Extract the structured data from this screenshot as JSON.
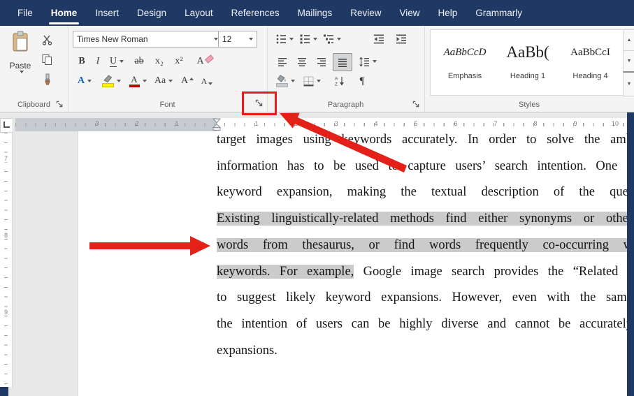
{
  "tabs": {
    "items": [
      "File",
      "Home",
      "Insert",
      "Design",
      "Layout",
      "References",
      "Mailings",
      "Review",
      "View",
      "Help",
      "Grammarly"
    ],
    "active": "Home"
  },
  "ribbon": {
    "clipboard": {
      "label": "Clipboard",
      "paste": "Paste"
    },
    "font": {
      "label": "Font",
      "name": "Times New Roman",
      "size": "12",
      "bold": "B",
      "italic": "I",
      "underline": "U",
      "strike": "ab",
      "subscript": "x₂",
      "superscript": "x²",
      "clear": "A",
      "effects": "A",
      "color": "A",
      "case": "Aa",
      "grow": "A",
      "shrink": "A"
    },
    "paragraph": {
      "label": "Paragraph"
    },
    "styles": {
      "label": "Styles",
      "cards": [
        {
          "sample": "AaBbCcD",
          "name": "Emphasis"
        },
        {
          "sample": "AaBb(",
          "name": "Heading 1"
        },
        {
          "sample": "AaBbCcI",
          "name": "Heading 4"
        }
      ]
    }
  },
  "icons": {
    "pilcrow": "¶",
    "up": "▲",
    "down": "▼",
    "more": "▼"
  },
  "ruler": {
    "h_margin_numbers": [
      "3",
      "2",
      "1"
    ],
    "h_numbers": [
      "1",
      "2",
      "3",
      "4",
      "5",
      "6",
      "7",
      "8",
      "9",
      "10"
    ],
    "v_numbers": [
      "7",
      "8",
      "9"
    ]
  },
  "annotation": {
    "accent": "#e81c1c"
  },
  "document": {
    "lines": [
      {
        "text": "target images using keywords accurately. In order to solve the amb"
      },
      {
        "text": "information has to be used to capture users’ search intention. One c"
      },
      {
        "text": "keyword expansion, making the textual description of the quer"
      },
      {
        "selected": "Existing linguistically-related methods find either synonyms or other"
      },
      {
        "selected": "words from thesaurus, or find words frequently co-occurring w"
      },
      {
        "selected": "keywords. For example,",
        "text": " Google image search provides the “Related s"
      },
      {
        "text": "to suggest likely keyword expansions. However, even with the same"
      },
      {
        "text": "the intention of users can be highly diverse and cannot be accurately"
      },
      {
        "text": "expansions."
      }
    ]
  }
}
